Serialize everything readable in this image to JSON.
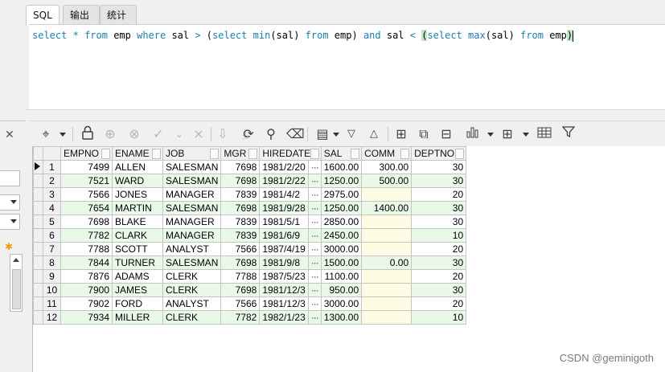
{
  "tabs": [
    {
      "label": "SQL",
      "active": true
    },
    {
      "label": "输出",
      "active": false
    },
    {
      "label": "统计",
      "active": false
    }
  ],
  "editor": {
    "query": "select * from emp where sal > (select min(sal) from emp) and sal < (select max(sal) from emp)",
    "tokens": [
      {
        "t": "select",
        "k": true
      },
      {
        "t": " "
      },
      {
        "t": "*",
        "k": true
      },
      {
        "t": " "
      },
      {
        "t": "from",
        "k": true
      },
      {
        "t": " emp "
      },
      {
        "t": "where",
        "k": true
      },
      {
        "t": " sal "
      },
      {
        "t": ">",
        "k": true
      },
      {
        "t": " (",
        "k": false
      },
      {
        "t": "select",
        "k": true
      },
      {
        "t": " "
      },
      {
        "t": "min",
        "k": true
      },
      {
        "t": "(sal) "
      },
      {
        "t": "from",
        "k": true
      },
      {
        "t": " emp) "
      },
      {
        "t": "and",
        "k": true
      },
      {
        "t": " sal "
      },
      {
        "t": "<",
        "k": true
      },
      {
        "t": " "
      },
      {
        "t": "(",
        "hl": true
      },
      {
        "t": "select",
        "k": true
      },
      {
        "t": " "
      },
      {
        "t": "max",
        "k": true
      },
      {
        "t": "(sal) "
      },
      {
        "t": "from",
        "k": true
      },
      {
        "t": " emp"
      },
      {
        "t": ")",
        "hl": true
      }
    ]
  },
  "toolbar": {
    "icons": [
      "grid-options-icon",
      "lock-icon",
      "add-record-icon",
      "delete-record-icon",
      "apply-icon",
      "cancel-edit-icon",
      "first-page-icon",
      "last-page-icon",
      "refresh-icon",
      "find-icon",
      "clear-icon",
      "filter-rows-icon",
      "sort-desc-icon",
      "sort-asc-icon",
      "import-icon",
      "export-icon",
      "data-view-icon",
      "chart-icon",
      "layout-icon",
      "table-view-icon",
      "funnel-icon"
    ]
  },
  "grid": {
    "columns": [
      "EMPNO",
      "ENAME",
      "JOB",
      "MGR",
      "HIREDATE",
      "SAL",
      "COMM",
      "DEPTNO"
    ],
    "ellipsis": "···",
    "current_row_indicator": "▶",
    "rows": [
      {
        "rn": "1",
        "empno": "7499",
        "ename": "ALLEN",
        "job": "SALESMAN",
        "mgr": "7698",
        "hiredate": "1981/2/20",
        "sal": "1600.00",
        "comm": "300.00",
        "deptno": "30"
      },
      {
        "rn": "2",
        "empno": "7521",
        "ename": "WARD",
        "job": "SALESMAN",
        "mgr": "7698",
        "hiredate": "1981/2/22",
        "sal": "1250.00",
        "comm": "500.00",
        "deptno": "30"
      },
      {
        "rn": "3",
        "empno": "7566",
        "ename": "JONES",
        "job": "MANAGER",
        "mgr": "7839",
        "hiredate": "1981/4/2",
        "sal": "2975.00",
        "comm": "",
        "deptno": "20"
      },
      {
        "rn": "4",
        "empno": "7654",
        "ename": "MARTIN",
        "job": "SALESMAN",
        "mgr": "7698",
        "hiredate": "1981/9/28",
        "sal": "1250.00",
        "comm": "1400.00",
        "deptno": "30"
      },
      {
        "rn": "5",
        "empno": "7698",
        "ename": "BLAKE",
        "job": "MANAGER",
        "mgr": "7839",
        "hiredate": "1981/5/1",
        "sal": "2850.00",
        "comm": "",
        "deptno": "30"
      },
      {
        "rn": "6",
        "empno": "7782",
        "ename": "CLARK",
        "job": "MANAGER",
        "mgr": "7839",
        "hiredate": "1981/6/9",
        "sal": "2450.00",
        "comm": "",
        "deptno": "10"
      },
      {
        "rn": "7",
        "empno": "7788",
        "ename": "SCOTT",
        "job": "ANALYST",
        "mgr": "7566",
        "hiredate": "1987/4/19",
        "sal": "3000.00",
        "comm": "",
        "deptno": "20"
      },
      {
        "rn": "8",
        "empno": "7844",
        "ename": "TURNER",
        "job": "SALESMAN",
        "mgr": "7698",
        "hiredate": "1981/9/8",
        "sal": "1500.00",
        "comm": "0.00",
        "deptno": "30"
      },
      {
        "rn": "9",
        "empno": "7876",
        "ename": "ADAMS",
        "job": "CLERK",
        "mgr": "7788",
        "hiredate": "1987/5/23",
        "sal": "1100.00",
        "comm": "",
        "deptno": "20"
      },
      {
        "rn": "10",
        "empno": "7900",
        "ename": "JAMES",
        "job": "CLERK",
        "mgr": "7698",
        "hiredate": "1981/12/3",
        "sal": "950.00",
        "comm": "",
        "deptno": "30"
      },
      {
        "rn": "11",
        "empno": "7902",
        "ename": "FORD",
        "job": "ANALYST",
        "mgr": "7566",
        "hiredate": "1981/12/3",
        "sal": "3000.00",
        "comm": "",
        "deptno": "20"
      },
      {
        "rn": "12",
        "empno": "7934",
        "ename": "MILLER",
        "job": "CLERK",
        "mgr": "7782",
        "hiredate": "1982/1/23",
        "sal": "1300.00",
        "comm": "",
        "deptno": "10"
      }
    ]
  },
  "watermark": "CSDN @geminigoth",
  "colors": {
    "keyword": "#1a7fa8",
    "row_alt": "#e8f9e8",
    "null_cell": "#fefde3",
    "bracket_highlight": "#bfe7c8"
  }
}
